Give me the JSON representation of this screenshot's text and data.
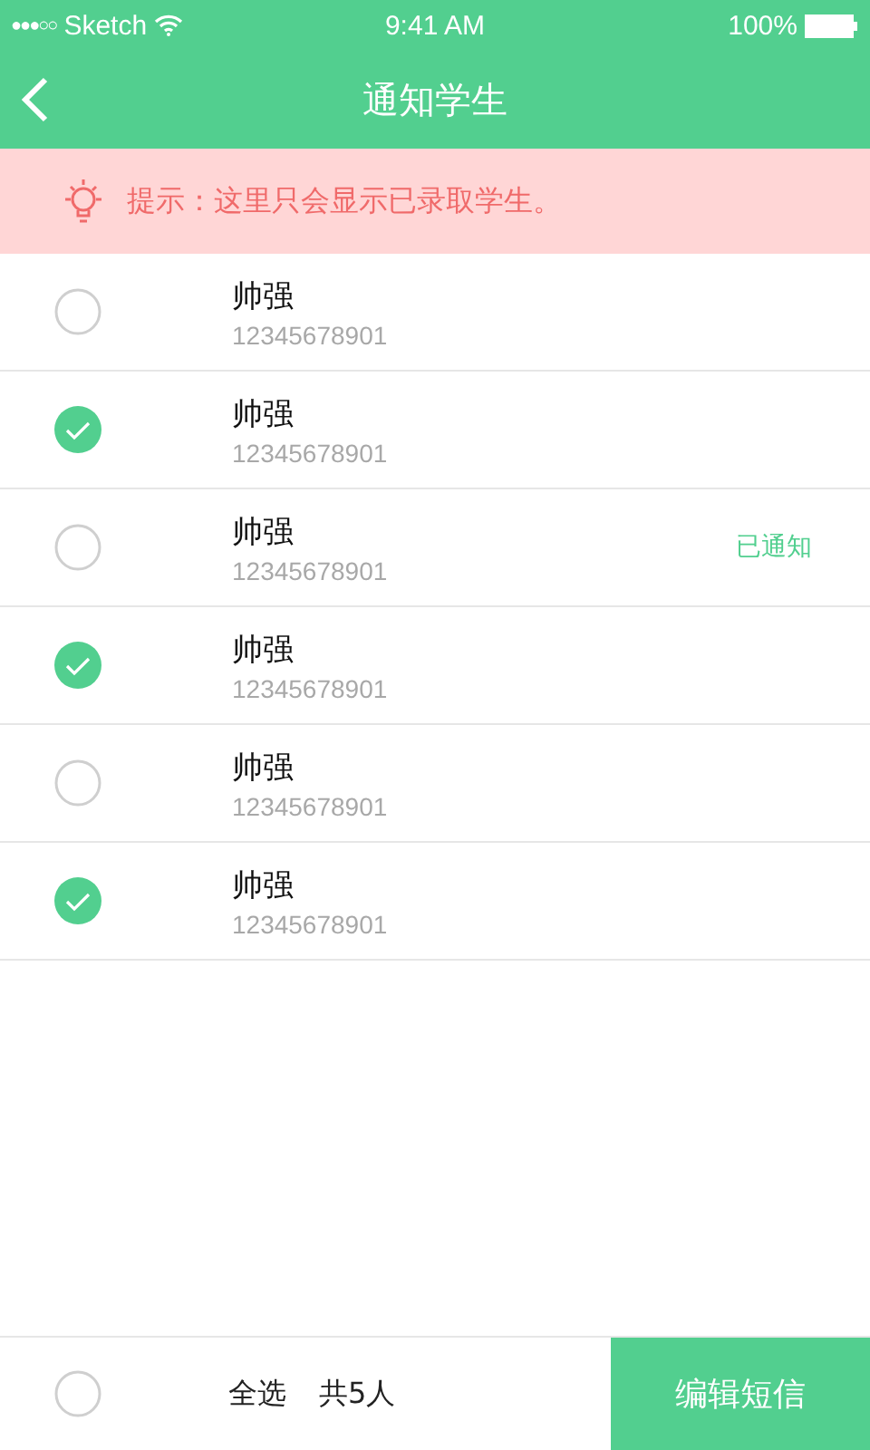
{
  "status_bar": {
    "signal_dots": "●●●○○",
    "carrier": "Sketch",
    "time": "9:41 AM",
    "battery": "100%"
  },
  "nav": {
    "title": "通知学生"
  },
  "tip": "提示：这里只会显示已录取学生。",
  "students": [
    {
      "name": "帅强",
      "phone": "12345678901",
      "checked": false
    },
    {
      "name": "帅强",
      "phone": "12345678901",
      "checked": true
    },
    {
      "name": "帅强",
      "phone": "12345678901",
      "checked": false,
      "status": "已通知"
    },
    {
      "name": "帅强",
      "phone": "12345678901",
      "checked": true
    },
    {
      "name": "帅强",
      "phone": "12345678901",
      "checked": false
    },
    {
      "name": "帅强",
      "phone": "12345678901",
      "checked": true
    }
  ],
  "footer": {
    "select_all": {
      "label": "全选",
      "checked": false
    },
    "count": "共5人",
    "button": "编辑短信"
  }
}
